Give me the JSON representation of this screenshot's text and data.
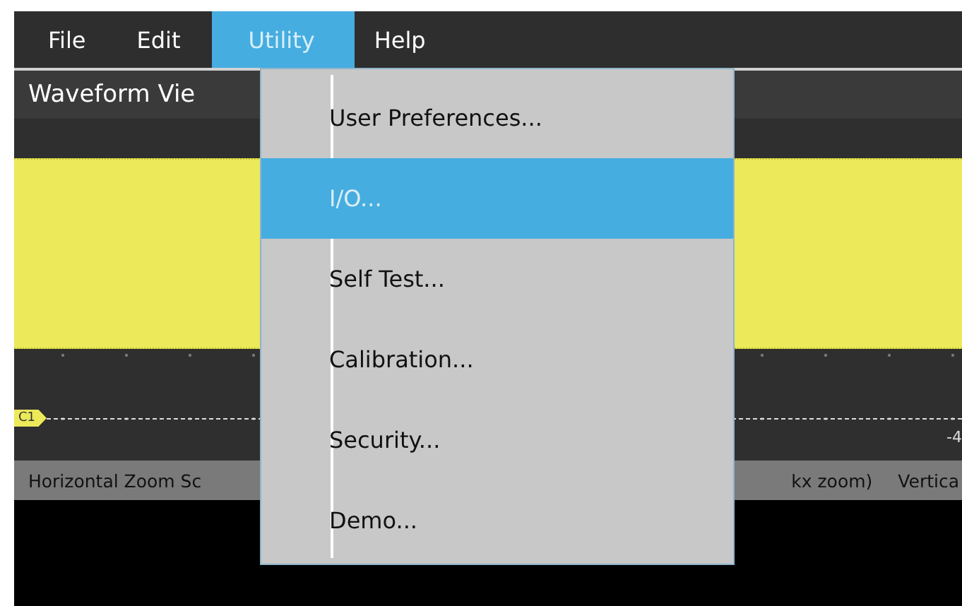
{
  "menubar": [
    {
      "label": "File",
      "selected": false
    },
    {
      "label": "Edit",
      "selected": false
    },
    {
      "label": "Utility",
      "selected": true
    },
    {
      "label": "Help",
      "selected": false
    }
  ],
  "waveform_view": {
    "title": "Waveform Vie",
    "channel_label": "C1",
    "axis_label": "-4"
  },
  "status_bar": {
    "left": "Horizontal Zoom Sc",
    "middle": "kx zoom)",
    "right": "Vertica"
  },
  "dropdown": {
    "items": [
      {
        "label": "User Preferences...",
        "selected": false
      },
      {
        "label": "I/O...",
        "selected": true
      },
      {
        "label": "Self Test...",
        "selected": false
      },
      {
        "label": "Calibration...",
        "selected": false
      },
      {
        "label": "Security...",
        "selected": false
      },
      {
        "label": "Demo...",
        "selected": false
      }
    ]
  }
}
